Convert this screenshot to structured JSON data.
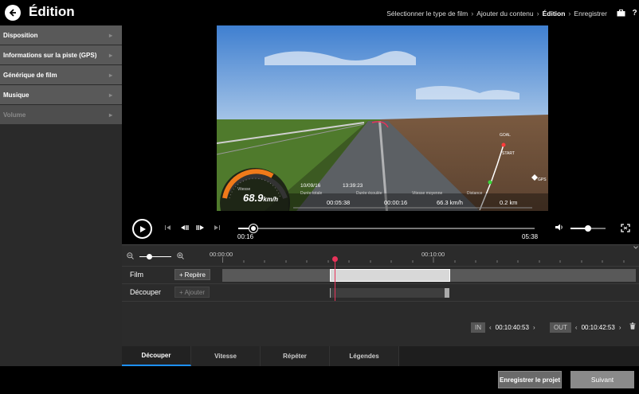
{
  "header": {
    "title": "Édition",
    "breadcrumbs": [
      {
        "label": "Sélectionner le type de film"
      },
      {
        "label": "Ajouter du contenu"
      },
      {
        "label": "Édition"
      },
      {
        "label": "Enregistrer"
      }
    ],
    "icons": [
      "back-arrow-icon",
      "briefcase-icon",
      "help-icon"
    ],
    "help_label": "?"
  },
  "sidebar": {
    "items": [
      {
        "label": "Disposition",
        "enabled": true
      },
      {
        "label": "Informations sur la piste (GPS)",
        "enabled": true
      },
      {
        "label": "Générique de film",
        "enabled": true
      },
      {
        "label": "Musique",
        "enabled": true
      },
      {
        "label": "Volume",
        "enabled": false
      }
    ]
  },
  "video_overlay": {
    "speed_label": "Vitesse",
    "speed_value": "68.9",
    "speed_unit": "km/h",
    "date": "10/09/16",
    "time": "13:39:23",
    "labels": {
      "total": "Durée totale",
      "elapsed": "Durée écoulée",
      "avg_speed": "Vitesse moyenne",
      "distance": "Distance"
    },
    "values": {
      "total": "00:05:38",
      "elapsed": "00:00:16",
      "avg_speed": "66.3 km/h",
      "distance": "0.2 km"
    },
    "map_goal": "GOAL",
    "map_start": "START",
    "gps_label": "GPS"
  },
  "player": {
    "current_time": "00:16",
    "total_time": "05:38",
    "progress": 0.05,
    "volume": 0.5
  },
  "timeline": {
    "ruler_labels": [
      "00:00:00",
      "00:10:00"
    ],
    "tracks": [
      {
        "label": "Film",
        "button": "Repère"
      },
      {
        "label": "Découper",
        "button": "Ajouter"
      }
    ],
    "in_label": "IN",
    "in_time": "00:10:40:53",
    "out_label": "OUT",
    "out_time": "00:10:42:53",
    "zoom_level": 0.3
  },
  "tabs": [
    {
      "label": "Découper",
      "active": true
    },
    {
      "label": "Vitesse",
      "active": false
    },
    {
      "label": "Répéter",
      "active": false
    },
    {
      "label": "Légendes",
      "active": false
    }
  ],
  "footer": {
    "save_label": "Enregistrer le projet",
    "next_label": "Suivant"
  },
  "colors": {
    "accent_blue": "#1e90ff",
    "playhead": "#e8335a",
    "speedo_orange": "#f07a1a"
  }
}
